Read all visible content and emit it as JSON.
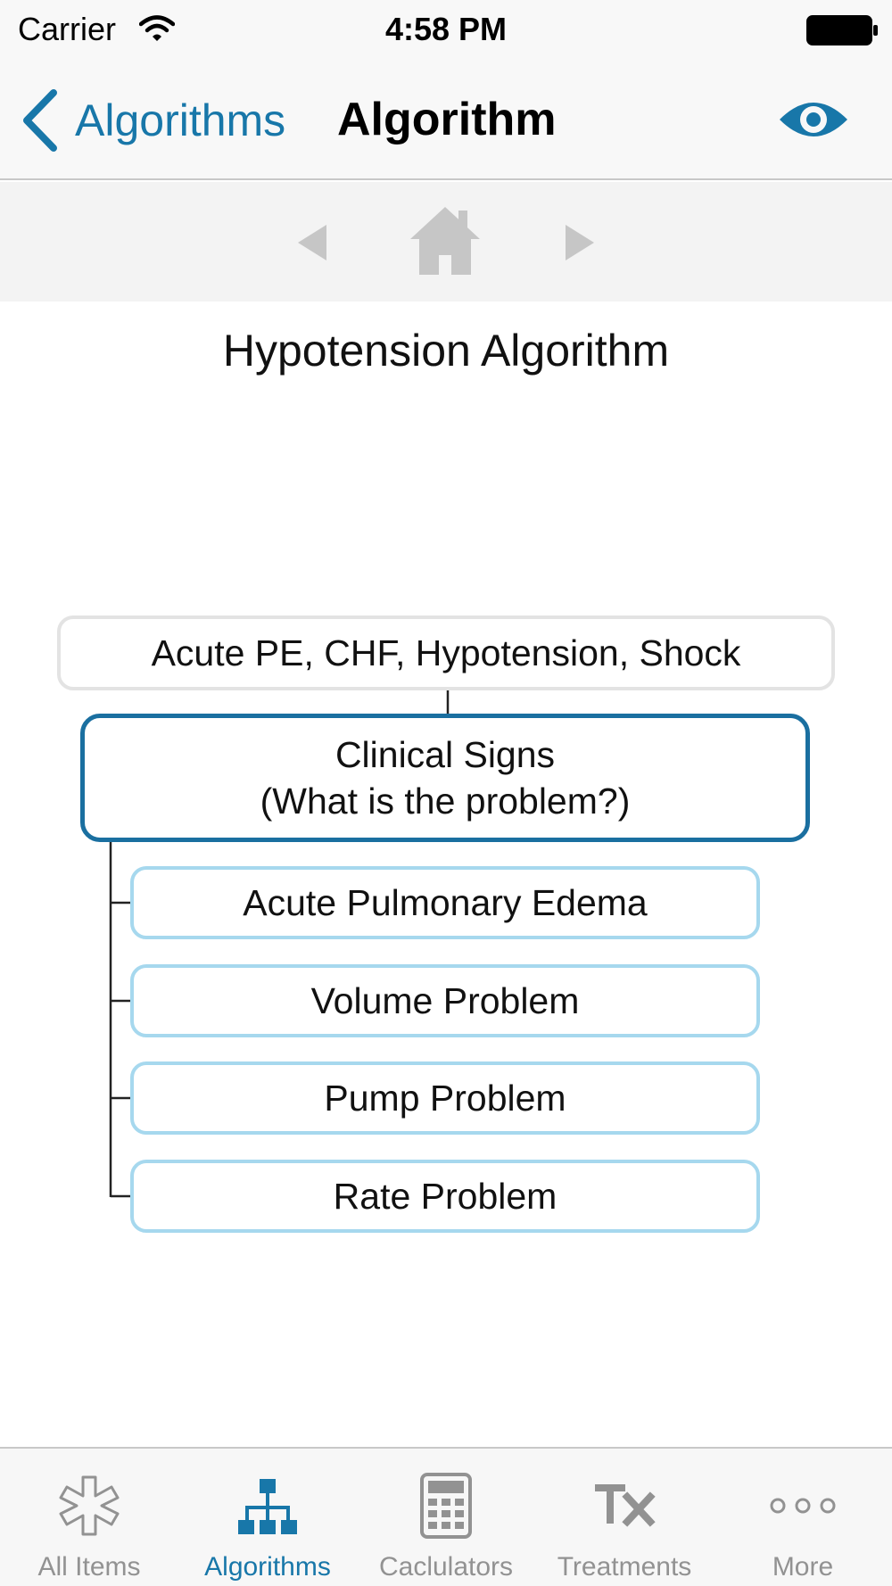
{
  "status_bar": {
    "carrier": "Carrier",
    "time": "4:58 PM"
  },
  "nav": {
    "back_label": "Algorithms",
    "title": "Algorithm",
    "accent_color": "#1877a9"
  },
  "toolbar": {
    "buttons": [
      "previous-arrow-icon",
      "home-icon",
      "next-arrow-icon"
    ]
  },
  "algorithm": {
    "title": "Hypotension Algorithm",
    "root": "Acute PE, CHF, Hypotension, Shock",
    "clinical": {
      "line1": "Clinical Signs",
      "line2": "(What is the problem?)"
    },
    "children": [
      "Acute Pulmonary Edema",
      "Volume Problem",
      "Pump Problem",
      "Rate Problem"
    ]
  },
  "tabs": [
    {
      "label": "All Items",
      "icon": "asterisk-outline-icon",
      "active": false
    },
    {
      "label": "Algorithms",
      "icon": "hierarchy-icon",
      "active": true
    },
    {
      "label": "Caclulators",
      "icon": "calculator-icon",
      "active": false
    },
    {
      "label": "Treatments",
      "icon": "tx-icon",
      "active": false
    },
    {
      "label": "More",
      "icon": "more-dots-icon",
      "active": false
    }
  ]
}
